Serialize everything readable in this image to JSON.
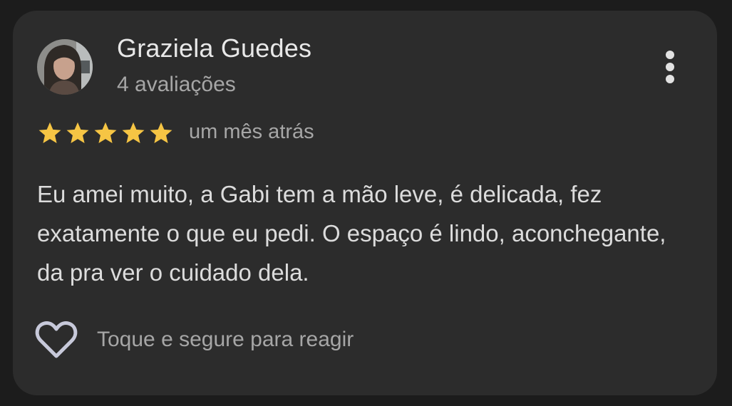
{
  "review": {
    "author_name": "Graziela Guedes",
    "author_reviews": "4 avaliações",
    "rating": 5,
    "rating_max": 5,
    "time_ago": "um mês atrás",
    "text": "Eu amei muito, a Gabi tem a mão leve, é delicada, fez exatamente o que eu pedi. O espaço é lindo, aconchegante, da pra ver o cuidado dela.",
    "react_hint": "Toque e segure para reagir"
  },
  "icons": {
    "more": "more-vert-icon",
    "star": "star-icon",
    "react": "heart-outline-icon"
  },
  "colors": {
    "background": "#1c1c1c",
    "card": "#2c2c2c",
    "star": "#f6c544",
    "primary_text": "#e8e8e8",
    "secondary_text": "#a6a6a6",
    "heart_outline": "#c7c9da"
  }
}
